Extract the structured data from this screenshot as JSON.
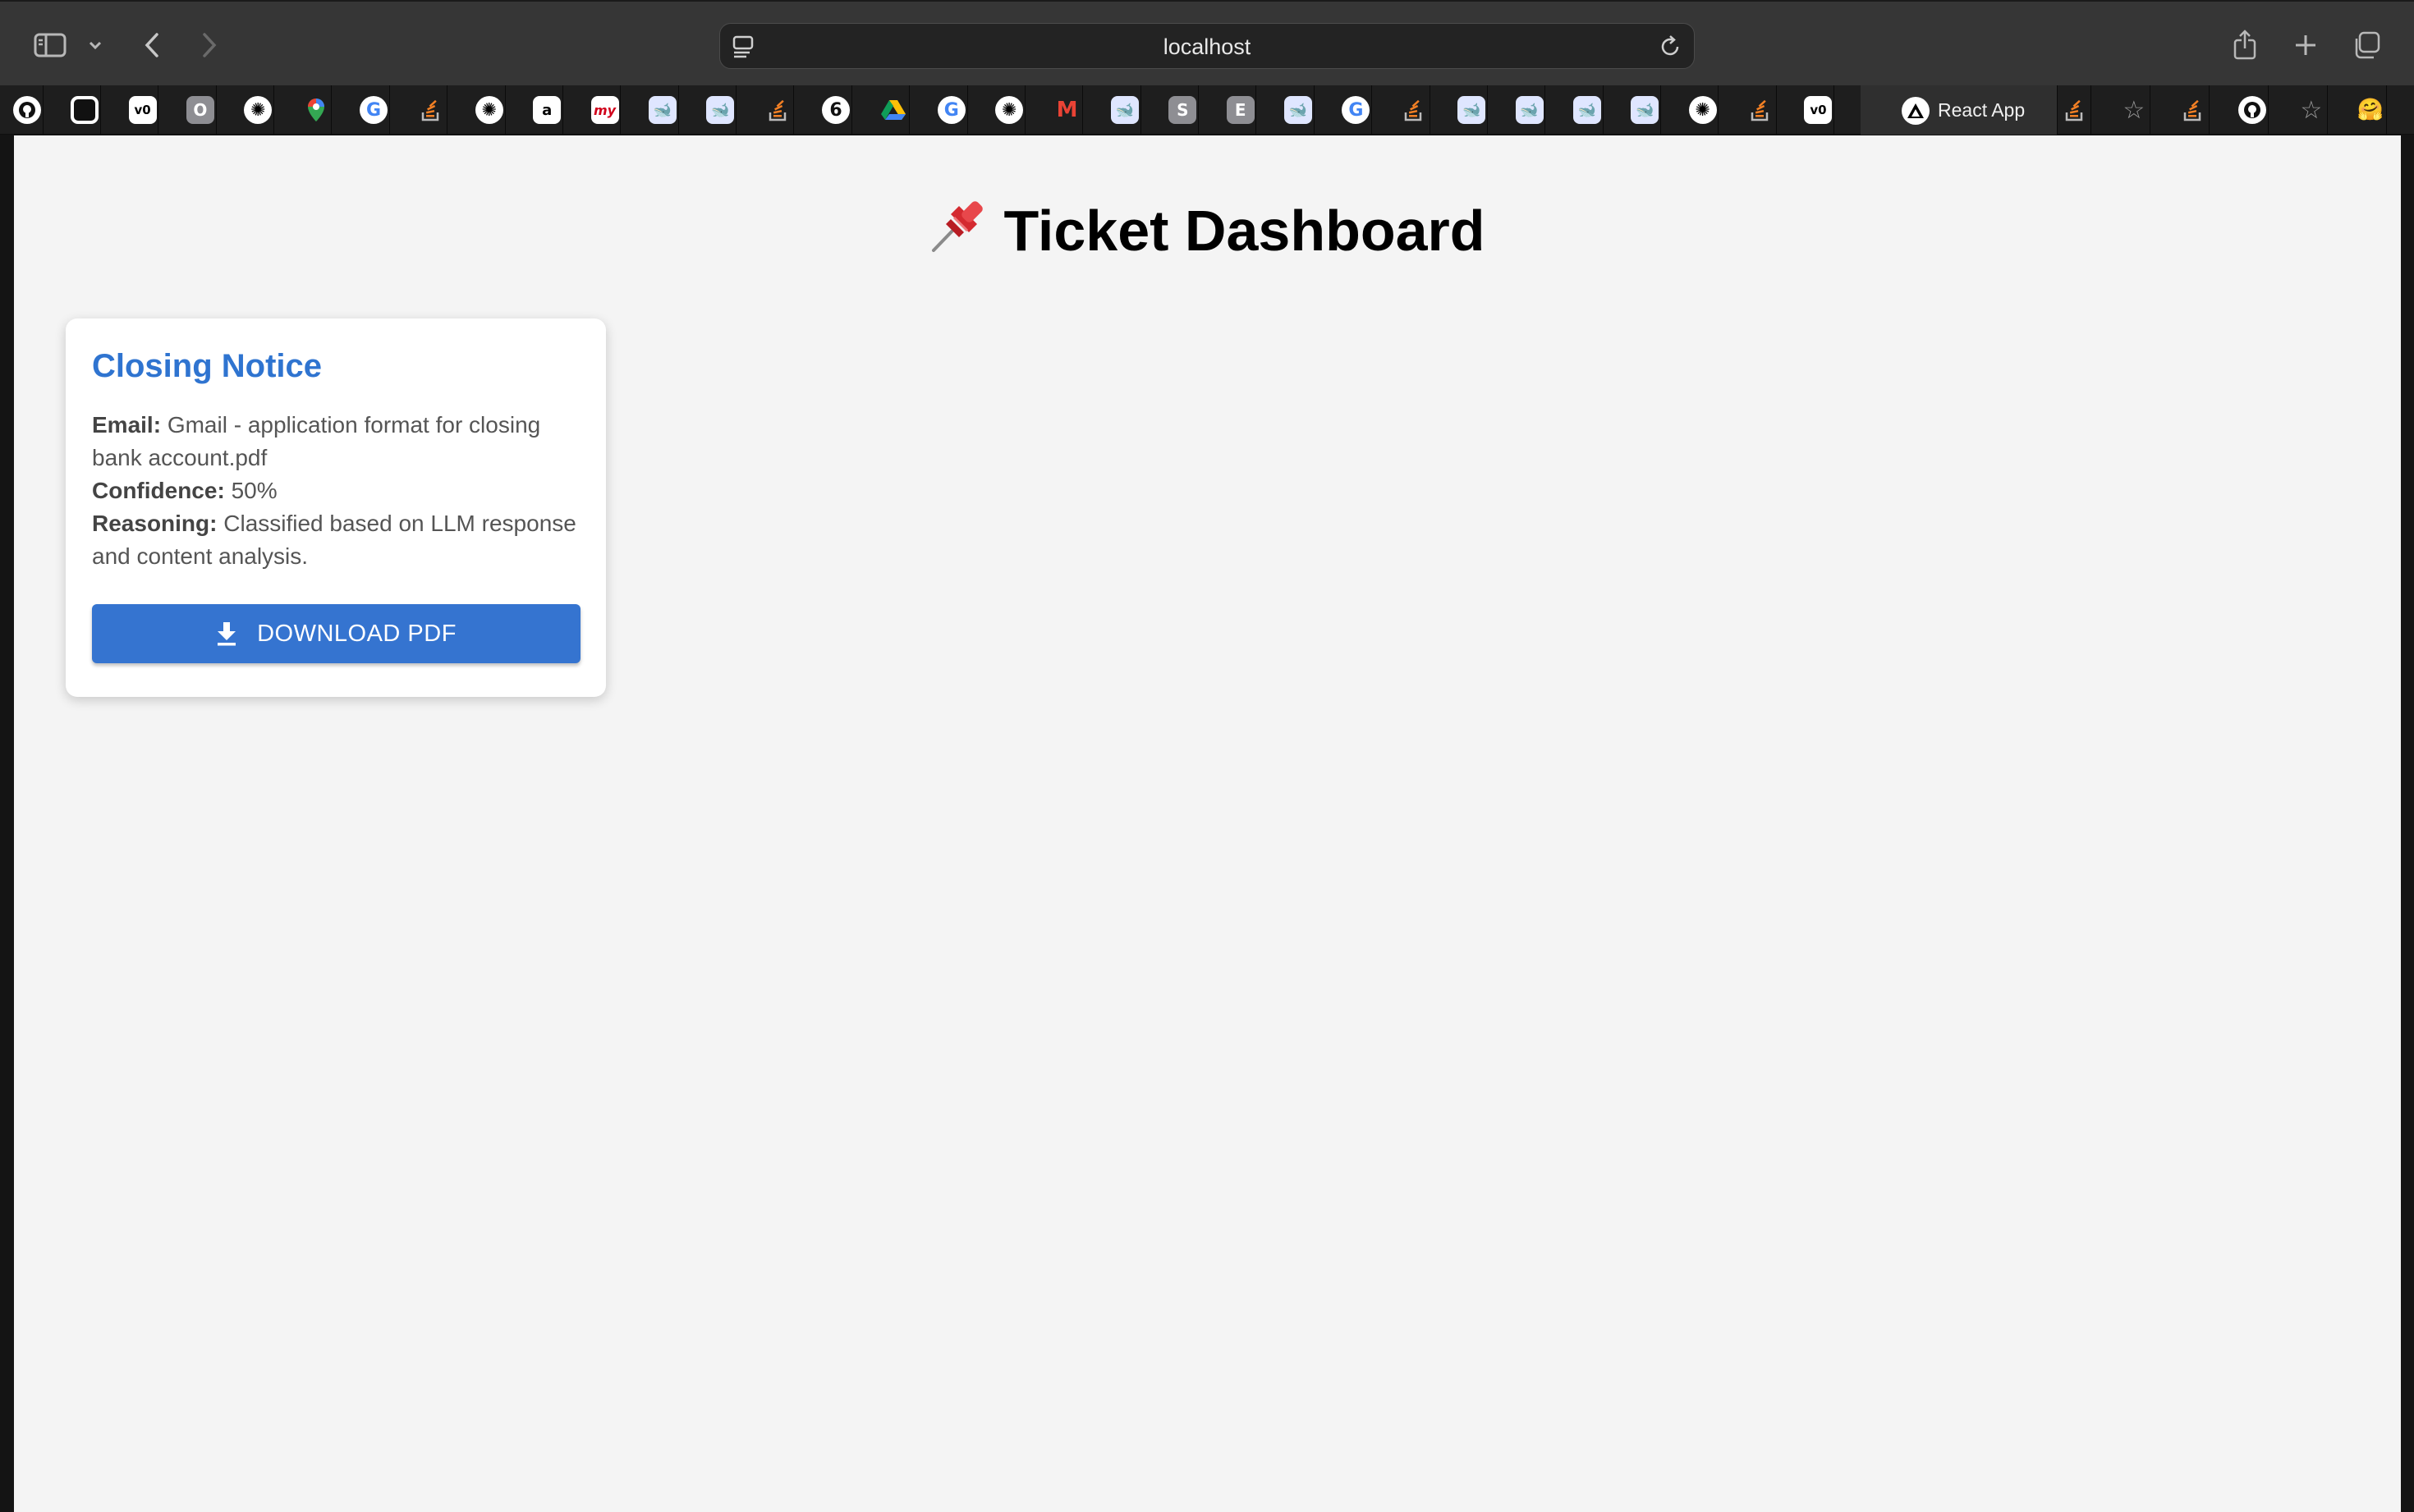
{
  "browser": {
    "address": "localhost",
    "active_tab": {
      "label": "React App"
    },
    "pinned_tabs": [
      {
        "name": "github-tab",
        "icon": "github-icon",
        "glyph": ""
      },
      {
        "name": "ring-tab",
        "icon": "ring-icon",
        "glyph": ""
      },
      {
        "name": "v0-tab",
        "icon": "v0-icon",
        "glyph": "v0"
      },
      {
        "name": "o-tab",
        "icon": "o-icon",
        "glyph": "O"
      },
      {
        "name": "chatgpt-tab",
        "icon": "chatgpt-icon",
        "glyph": "✺"
      },
      {
        "name": "maps-tab",
        "icon": "google-maps-icon",
        "glyph": ""
      },
      {
        "name": "google-tab",
        "icon": "google-icon",
        "glyph": "G"
      },
      {
        "name": "stackoverflow-tab",
        "icon": "stackoverflow-icon",
        "glyph": ""
      },
      {
        "name": "chatgpt-tab",
        "icon": "chatgpt-icon",
        "glyph": "✺"
      },
      {
        "name": "a-tab",
        "icon": "a-icon",
        "glyph": "a"
      },
      {
        "name": "my-tab",
        "icon": "my-icon",
        "glyph": "my"
      },
      {
        "name": "deepseek-tab",
        "icon": "deepseek-icon",
        "glyph": "🐋"
      },
      {
        "name": "deepseek-tab",
        "icon": "deepseek-icon",
        "glyph": "🐋"
      },
      {
        "name": "stackoverflow-tab",
        "icon": "stackoverflow-icon",
        "glyph": ""
      },
      {
        "name": "six-tab",
        "icon": "six-icon",
        "glyph": "6"
      },
      {
        "name": "drive-tab",
        "icon": "google-drive-icon",
        "glyph": ""
      },
      {
        "name": "google-tab",
        "icon": "google-icon",
        "glyph": "G"
      },
      {
        "name": "chatgpt-tab",
        "icon": "chatgpt-icon",
        "glyph": "✺"
      },
      {
        "name": "gmail-tab",
        "icon": "gmail-icon",
        "glyph": "M"
      },
      {
        "name": "deepseek-tab",
        "icon": "deepseek-icon",
        "glyph": "🐋"
      },
      {
        "name": "s-tab",
        "icon": "s-icon",
        "glyph": "S"
      },
      {
        "name": "e-tab",
        "icon": "e-icon",
        "glyph": "E"
      },
      {
        "name": "deepseek-tab",
        "icon": "deepseek-icon",
        "glyph": "🐋"
      },
      {
        "name": "google-tab",
        "icon": "google-icon",
        "glyph": "G"
      },
      {
        "name": "stackoverflow-tab",
        "icon": "stackoverflow-icon",
        "glyph": ""
      },
      {
        "name": "deepseek-tab",
        "icon": "deepseek-icon",
        "glyph": "🐋"
      },
      {
        "name": "deepseek-tab",
        "icon": "deepseek-icon",
        "glyph": "🐋"
      },
      {
        "name": "deepseek-tab",
        "icon": "deepseek-icon",
        "glyph": "🐋"
      },
      {
        "name": "deepseek-tab",
        "icon": "deepseek-icon",
        "glyph": "🐋"
      },
      {
        "name": "chatgpt-tab",
        "icon": "chatgpt-icon",
        "glyph": "✺"
      },
      {
        "name": "stackoverflow-tab",
        "icon": "stackoverflow-icon",
        "glyph": ""
      },
      {
        "name": "v0-tab",
        "icon": "v0-icon",
        "glyph": "v0"
      }
    ],
    "trailing_tabs": [
      {
        "name": "stackoverflow-tab",
        "icon": "stackoverflow-icon",
        "glyph": ""
      },
      {
        "name": "star-tab",
        "icon": "star-icon",
        "glyph": "☆"
      },
      {
        "name": "stackoverflow-tab",
        "icon": "stackoverflow-icon",
        "glyph": ""
      },
      {
        "name": "github-tab",
        "icon": "github-icon",
        "glyph": ""
      },
      {
        "name": "star-tab",
        "icon": "star-icon",
        "glyph": "☆"
      },
      {
        "name": "hugging-face-tab",
        "icon": "hugging-face-icon",
        "glyph": "🤗"
      }
    ]
  },
  "page": {
    "title_emoji": "📌",
    "title": "Ticket Dashboard",
    "tickets": [
      {
        "title": "Closing Notice",
        "email_label": "Email:",
        "email": "Gmail - application format for closing bank account.pdf",
        "confidence_label": "Confidence:",
        "confidence": "50%",
        "reasoning_label": "Reasoning:",
        "reasoning": "Classified based on LLM response and content analysis.",
        "button_label": "DOWNLOAD PDF"
      }
    ]
  },
  "colors": {
    "accent": "#3574d0",
    "card_title": "#2f74d0",
    "page_bg": "#f4f4f4"
  }
}
